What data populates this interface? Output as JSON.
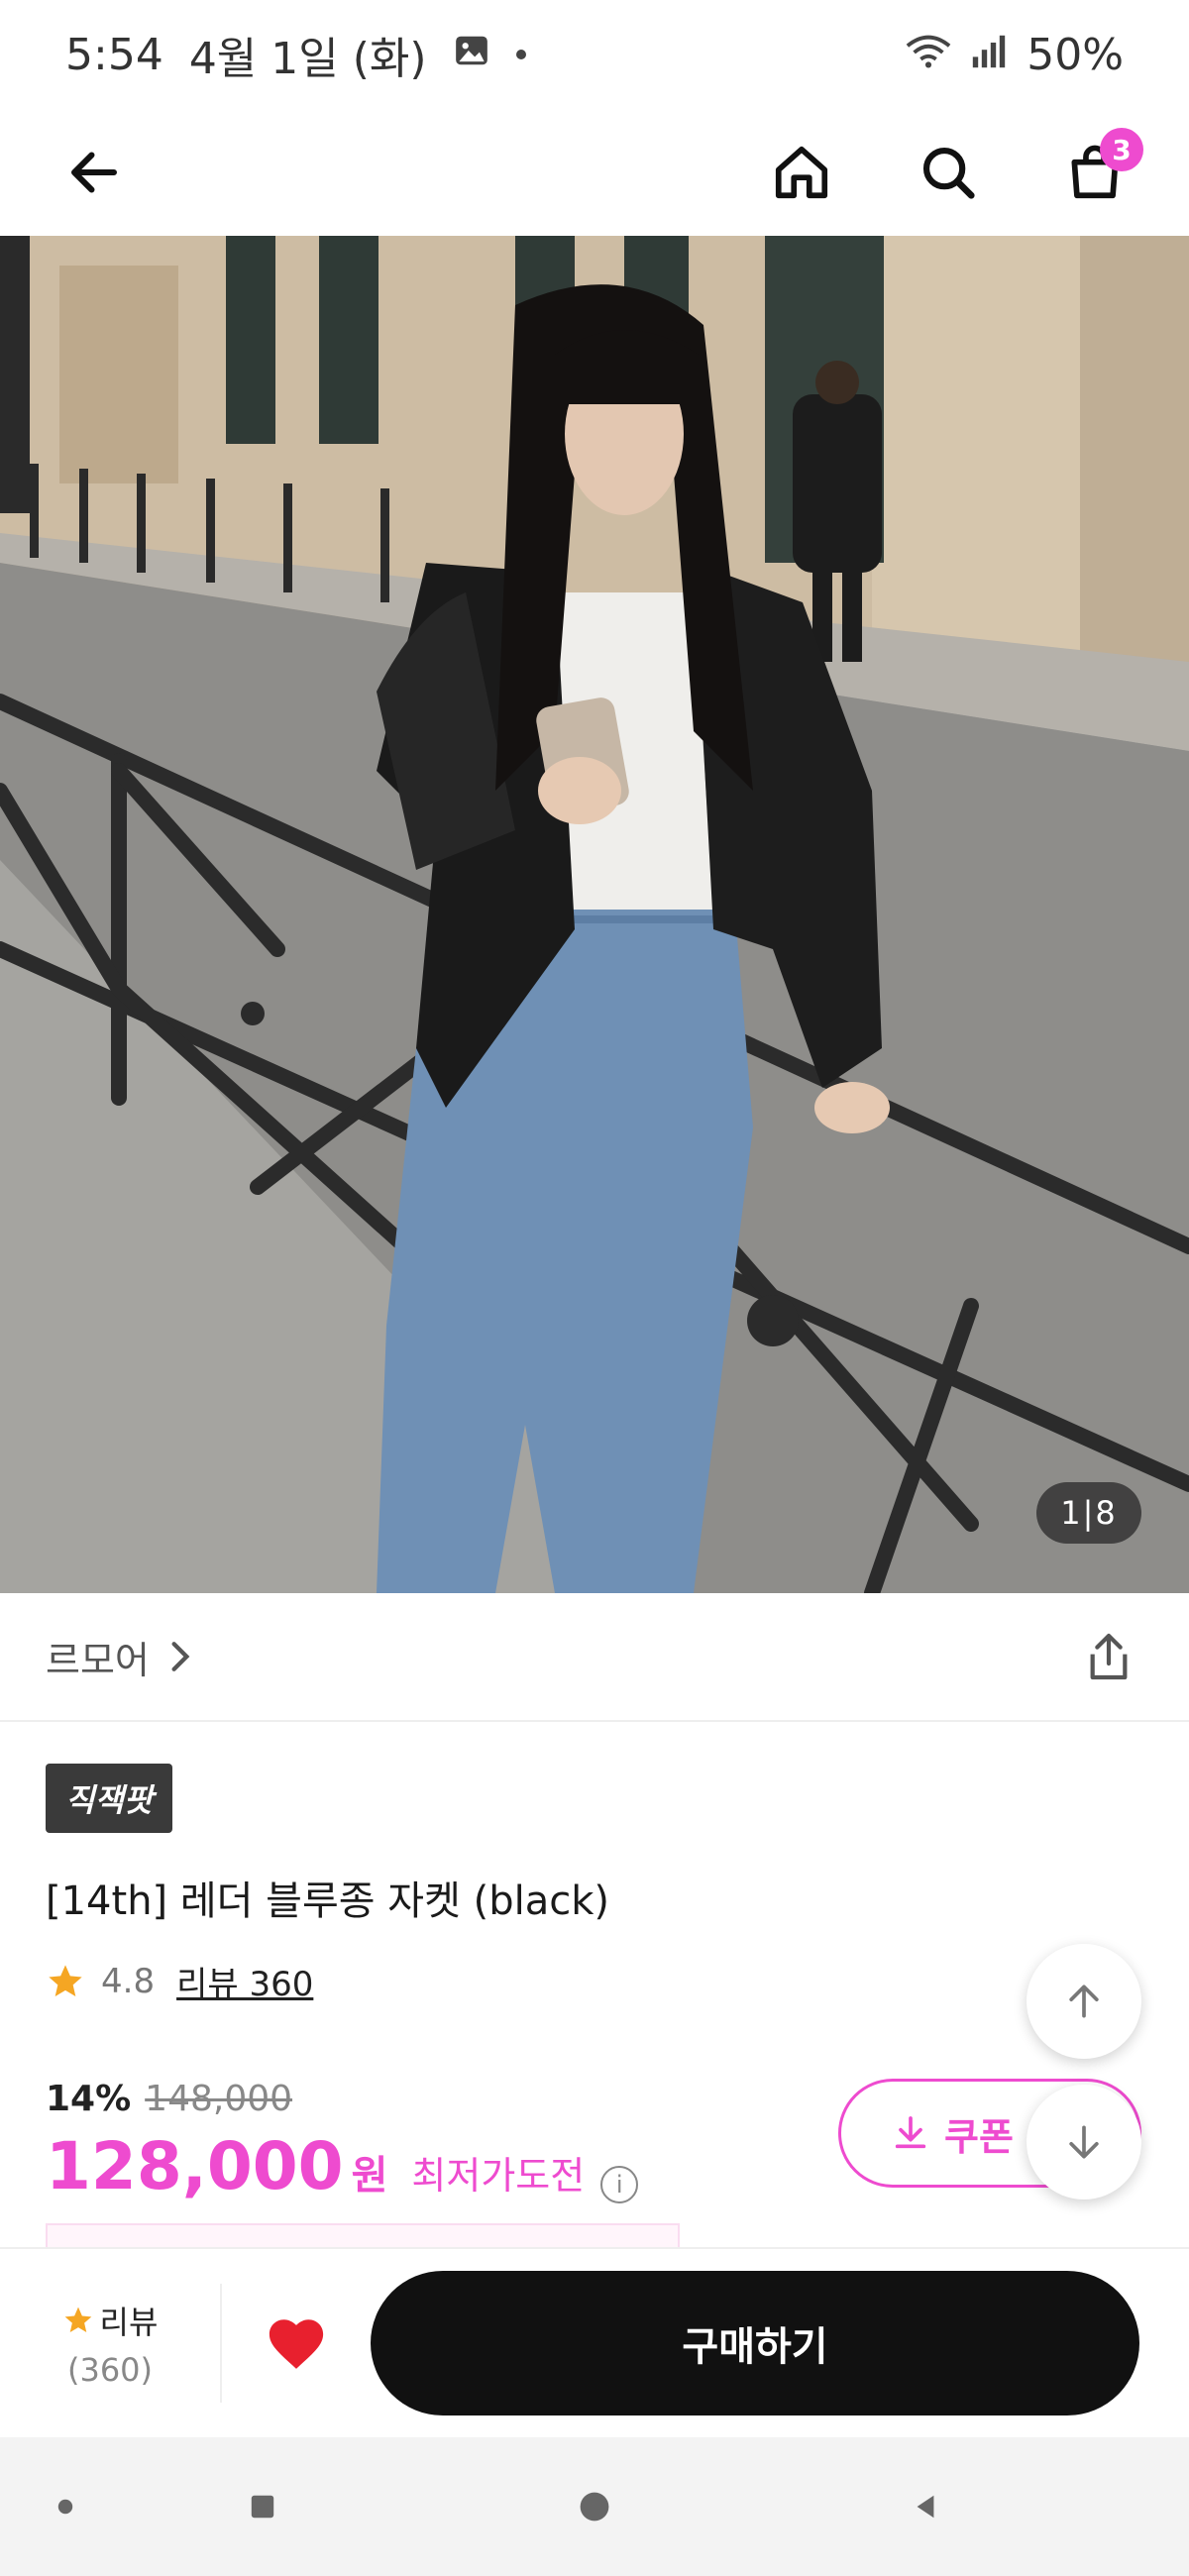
{
  "status_bar": {
    "time": "5:54",
    "date": "4월 1일 (화)",
    "battery": "50%"
  },
  "top_nav": {
    "cart_count": "3"
  },
  "hero": {
    "image_counter": "1|8"
  },
  "brand": {
    "name": "르모어"
  },
  "product": {
    "badge": "직잭팟",
    "title": "[14th] 레더 블루종 자켓 (black)",
    "rating": "4.8",
    "review_link": "리뷰 360",
    "discount_rate": "14%",
    "original_price": "148,000",
    "sale_price": "128,000",
    "currency": "원",
    "lowest_price_label": "최저가도전",
    "info_symbol": "i"
  },
  "coupon": {
    "label": "쿠폰"
  },
  "bottom_bar": {
    "review_label": "리뷰",
    "review_count": "(360)",
    "buy_label": "구매하기"
  },
  "colors": {
    "accent": "#ee4bcf",
    "buy_button": "#111111",
    "heart": "#e8202e",
    "star": "#f5a623"
  }
}
